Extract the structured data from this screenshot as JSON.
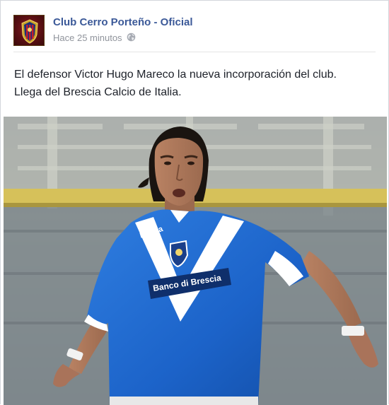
{
  "post": {
    "page_name": "Club Cerro Porteño - Oficial",
    "timestamp": "Hace 25 minutos",
    "privacy_icon": "globe-icon",
    "text_lines": [
      "El defensor Victor Hugo Mareco la nueva incorporación del club.",
      "Llega del Brescia Calcio de Italia."
    ],
    "photo": {
      "shirt_sponsor": "Banco di Brescia",
      "kit_brand": "Kappa"
    }
  },
  "colors": {
    "link": "#3b5998",
    "meta": "#90949c",
    "text": "#1d2129",
    "shirt": "#1f6fd6"
  }
}
